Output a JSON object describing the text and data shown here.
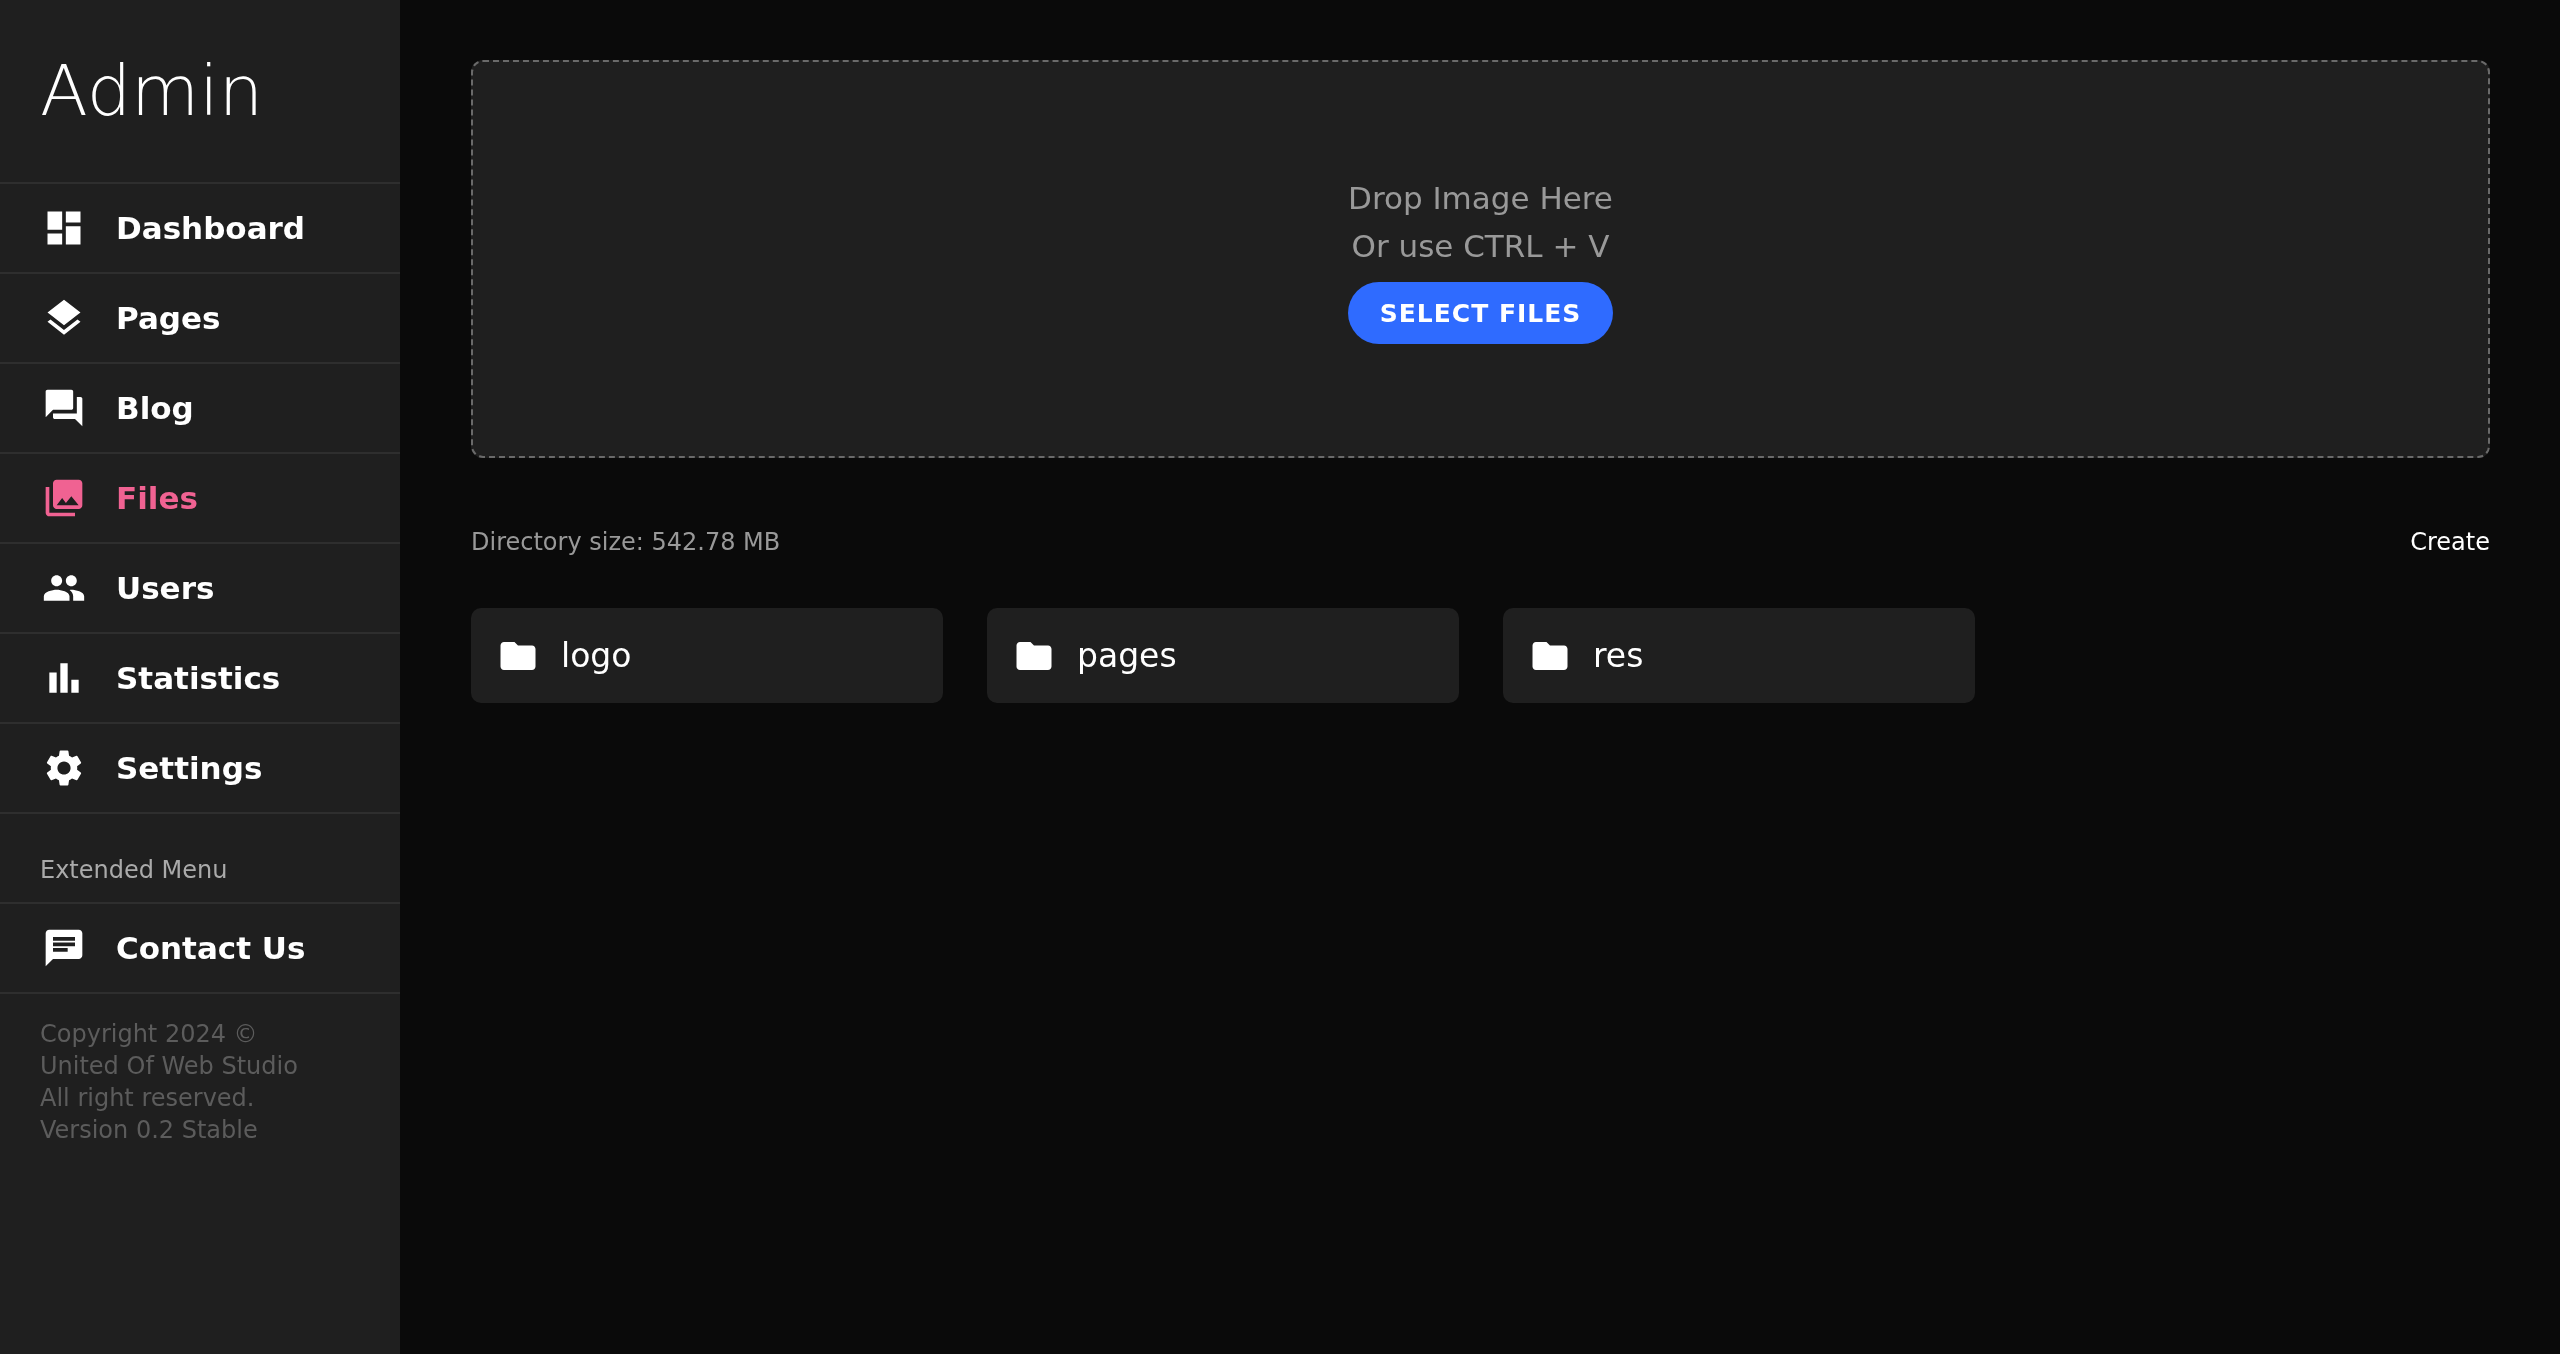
{
  "sidebar": {
    "title": "Admin",
    "items": [
      {
        "kind": "dashboard",
        "label": "Dashboard",
        "selected": false
      },
      {
        "kind": "layers",
        "label": "Pages",
        "selected": false
      },
      {
        "kind": "forum",
        "label": "Blog",
        "selected": false
      },
      {
        "kind": "photos",
        "label": "Files",
        "selected": true
      },
      {
        "kind": "people",
        "label": "Users",
        "selected": false
      },
      {
        "kind": "chart",
        "label": "Statistics",
        "selected": false
      },
      {
        "kind": "settings",
        "label": "Settings",
        "selected": false
      }
    ],
    "extended_heading": "Extended Menu",
    "extended_items": [
      {
        "kind": "chat",
        "label": "Contact Us",
        "selected": false
      }
    ],
    "footer": [
      "Copyright 2024 ©",
      "United Of Web Studio",
      "All right reserved.",
      "Version 0.2 Stable"
    ]
  },
  "dropzone": {
    "line_1": "Drop Image Here",
    "line_2": "Or use CTRL + V",
    "button": "SELECT FILES"
  },
  "directory_size": "Directory size: 542.78 MB",
  "create": "Create",
  "folders": [
    {
      "name": "logo"
    },
    {
      "name": "pages"
    },
    {
      "name": "res"
    }
  ]
}
